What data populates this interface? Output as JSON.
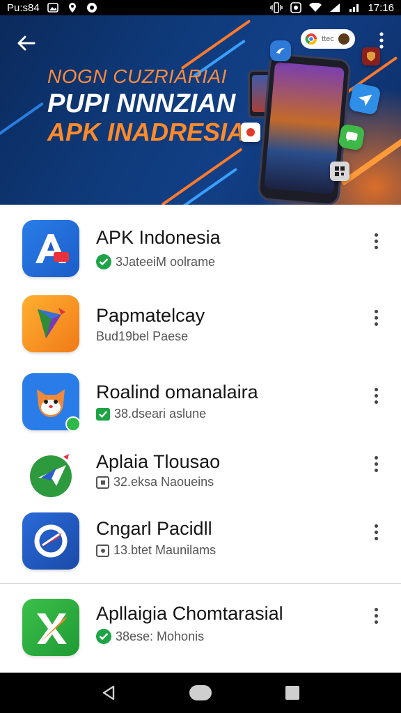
{
  "status_bar": {
    "left_text": "Pu:s84",
    "time": "17:16"
  },
  "hero": {
    "line1": "NOGN CUZRIARIAI",
    "line2": "PUPI NNNZIAN",
    "line3": "APK INADRESIA",
    "chrome_text": "ttec"
  },
  "apps": [
    {
      "name": "APK Indonesia",
      "subtitle": "3JateeiM oolrame",
      "badge": "check-circle"
    },
    {
      "name": "Papmatelcay",
      "subtitle": "Bud19bel Paese",
      "badge": "none"
    },
    {
      "name": "Roalind omanalaira",
      "subtitle": "38.dseari aslune",
      "badge": "check-square"
    },
    {
      "name": "Aplaia Tlousao",
      "subtitle": "32.eksa Naoueins",
      "badge": "square"
    },
    {
      "name": "Cngarl Pacidll",
      "subtitle": "13.btet Maunilams",
      "badge": "square"
    },
    {
      "name": "Apllaigia Chomtarasial",
      "subtitle": "38ese: Mohonis",
      "badge": "check-circle"
    }
  ],
  "colors": {
    "hero_bg": "#0f3b7c",
    "hero_accent": "#ff8a2a",
    "verified_green": "#1ea446"
  }
}
